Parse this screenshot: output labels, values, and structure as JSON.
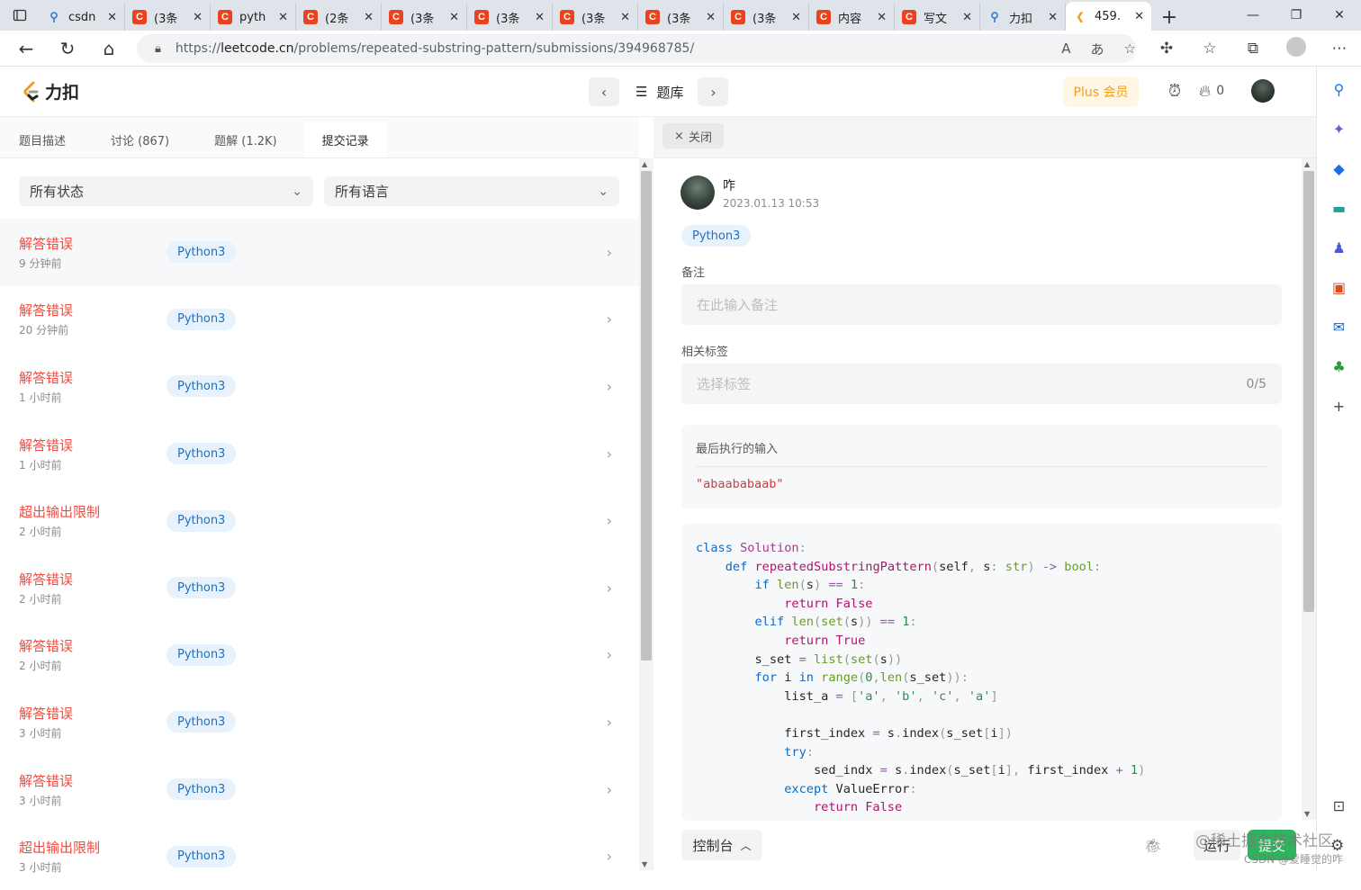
{
  "browser": {
    "tabs": [
      {
        "title": "csdn",
        "favicon": "search",
        "active": false
      },
      {
        "title": "(3条",
        "favicon": "csdn",
        "active": false
      },
      {
        "title": "pyth",
        "favicon": "csdn",
        "active": false
      },
      {
        "title": "(2条",
        "favicon": "csdn",
        "active": false
      },
      {
        "title": "(3条",
        "favicon": "csdn",
        "active": false
      },
      {
        "title": "(3条",
        "favicon": "csdn",
        "active": false
      },
      {
        "title": "(3条",
        "favicon": "csdn",
        "active": false
      },
      {
        "title": "(3条",
        "favicon": "csdn",
        "active": false
      },
      {
        "title": "(3条",
        "favicon": "csdn",
        "active": false
      },
      {
        "title": "内容",
        "favicon": "csdn",
        "active": false
      },
      {
        "title": "写文",
        "favicon": "csdn",
        "active": false
      },
      {
        "title": "力扣",
        "favicon": "search",
        "active": false
      },
      {
        "title": "459.",
        "favicon": "leetcode",
        "active": true
      }
    ],
    "url_scheme": "https://",
    "url_host": "leetcode.cn",
    "url_path": "/problems/repeated-substring-pattern/submissions/394968785/"
  },
  "header": {
    "logo_text": "力扣",
    "problemset_label": "题库",
    "plus_label": "Plus 会员",
    "streak_count": "0"
  },
  "left": {
    "tabs": [
      "题目描述",
      "讨论 (867)",
      "题解 (1.2K)",
      "提交记录"
    ],
    "active_tab": 3,
    "filter_status": "所有状态",
    "filter_lang": "所有语言",
    "submissions": [
      {
        "status": "解答错误",
        "time": "9 分钟前",
        "lang": "Python3"
      },
      {
        "status": "解答错误",
        "time": "20 分钟前",
        "lang": "Python3"
      },
      {
        "status": "解答错误",
        "time": "1 小时前",
        "lang": "Python3"
      },
      {
        "status": "解答错误",
        "time": "1 小时前",
        "lang": "Python3"
      },
      {
        "status": "超出输出限制",
        "time": "2 小时前",
        "lang": "Python3"
      },
      {
        "status": "解答错误",
        "time": "2 小时前",
        "lang": "Python3"
      },
      {
        "status": "解答错误",
        "time": "2 小时前",
        "lang": "Python3"
      },
      {
        "status": "解答错误",
        "time": "3 小时前",
        "lang": "Python3"
      },
      {
        "status": "解答错误",
        "time": "3 小时前",
        "lang": "Python3"
      },
      {
        "status": "超出输出限制",
        "time": "3 小时前",
        "lang": "Python3"
      }
    ]
  },
  "right": {
    "close_label": "关闭",
    "username": "咋",
    "datetime": "2023.01.13 10:53",
    "lang": "Python3",
    "note_label": "备注",
    "note_placeholder": "在此输入备注",
    "tags_label": "相关标签",
    "tags_placeholder": "选择标签",
    "tags_count": "0/5",
    "last_input_label": "最后执行的输入",
    "last_input_value": "\"abaababaab\"",
    "console_label": "控制台",
    "run_label": "运行",
    "submit_label": "提交"
  },
  "watermark": {
    "line1": "@稀土掘金技术社区",
    "line2": "CSDN @爱睡觉的咋"
  }
}
